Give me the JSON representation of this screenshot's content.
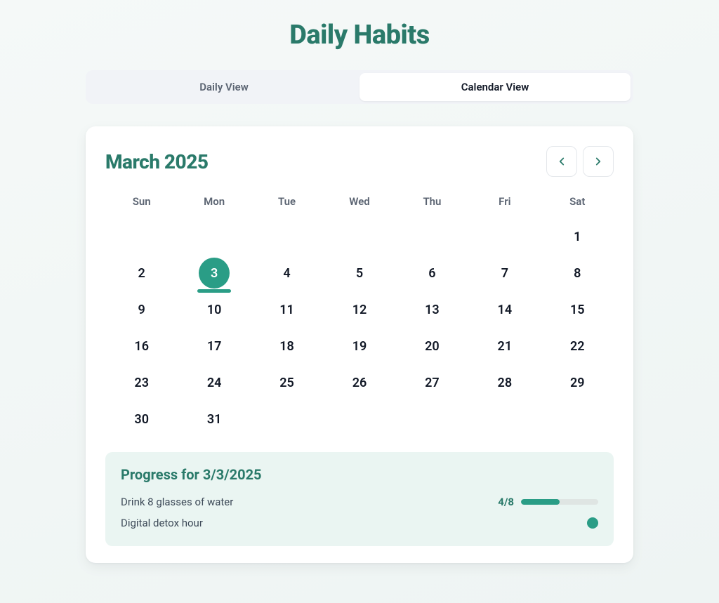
{
  "title": "Daily Habits",
  "tabs": {
    "daily": "Daily View",
    "calendar": "Calendar View",
    "active": "calendar"
  },
  "calendar": {
    "month_label": "March 2025",
    "weekdays": [
      "Sun",
      "Mon",
      "Tue",
      "Wed",
      "Thu",
      "Fri",
      "Sat"
    ],
    "leading_blanks": 6,
    "days_in_month": 31,
    "selected_day": 3
  },
  "progress": {
    "heading": "Progress for 3/3/2025",
    "items": [
      {
        "label": "Drink 8 glasses of water",
        "type": "count",
        "done": 4,
        "goal": 8
      },
      {
        "label": "Digital detox hour",
        "type": "boolean",
        "done": true
      }
    ]
  },
  "colors": {
    "accent": "#2a9d86",
    "accent_dark": "#2a7a6a"
  }
}
